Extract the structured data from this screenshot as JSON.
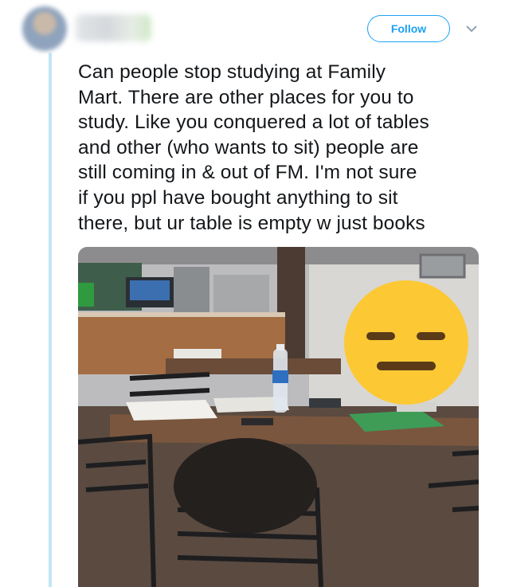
{
  "header": {
    "follow_label": "Follow",
    "icons": {
      "menu": "chevron-down-icon"
    }
  },
  "tweet": {
    "text": "Can people stop studying at Family\nMart. There are other places for you to\nstudy. Like you conquered a lot of tables\nand other (who wants to sit) people are\nstill coming in & out of FM. I'm not sure\nif you ppl have bought anything to sit\nthere, but ur table is empty w just books"
  },
  "colors": {
    "accent": "#1da1f2",
    "thread_line": "#c4e4f6",
    "text": "#14171a",
    "emoji_face": "#fcc935"
  }
}
